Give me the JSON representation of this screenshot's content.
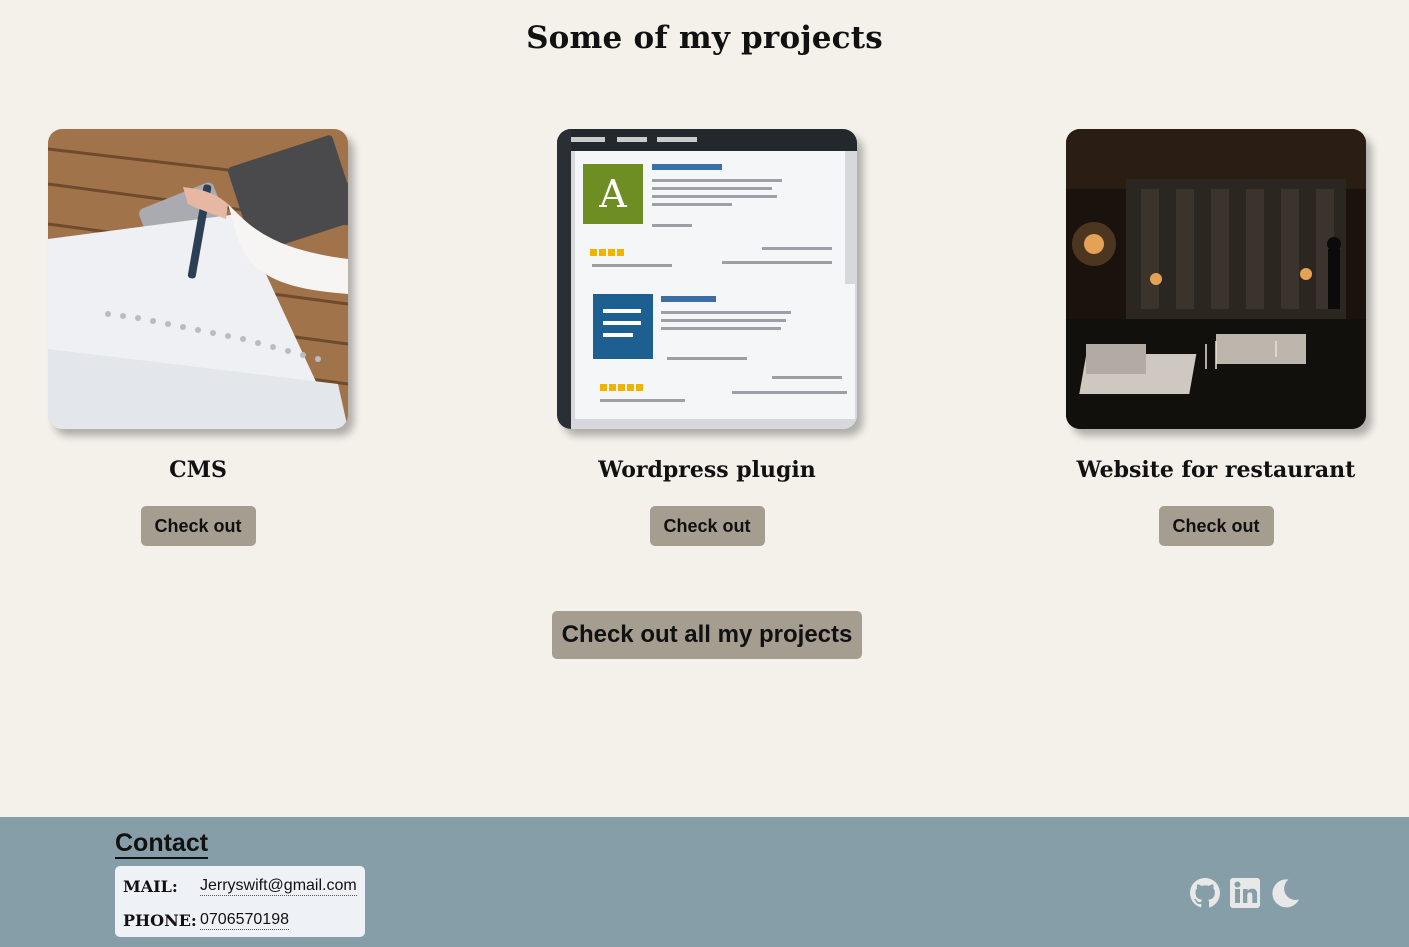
{
  "section": {
    "title": "Some of my projects"
  },
  "projects": [
    {
      "title": "CMS",
      "button_label": "Check out",
      "image_subject": "notebook-desk-photo"
    },
    {
      "title": "Wordpress plugin",
      "button_label": "Check out",
      "image_subject": "wordpress-plugins-screen-photo"
    },
    {
      "title": "Website for restaurant",
      "button_label": "Check out",
      "image_subject": "restaurant-interior-photo"
    }
  ],
  "all_projects_button": "Check out all my projects",
  "footer": {
    "contact_title": "Contact",
    "mail_label": "MAIL:",
    "mail_value": "Jerryswift@gmail.com",
    "phone_label": "PHONE:",
    "phone_value": "0706570198",
    "icons": [
      "github-icon",
      "linkedin-icon",
      "moon-icon"
    ]
  },
  "colors": {
    "page_background": "#f4f1eb",
    "button": "#a59d90",
    "footer": "#869ea8",
    "contact_box": "#eef2f7",
    "icon": "#e8e8e8"
  }
}
